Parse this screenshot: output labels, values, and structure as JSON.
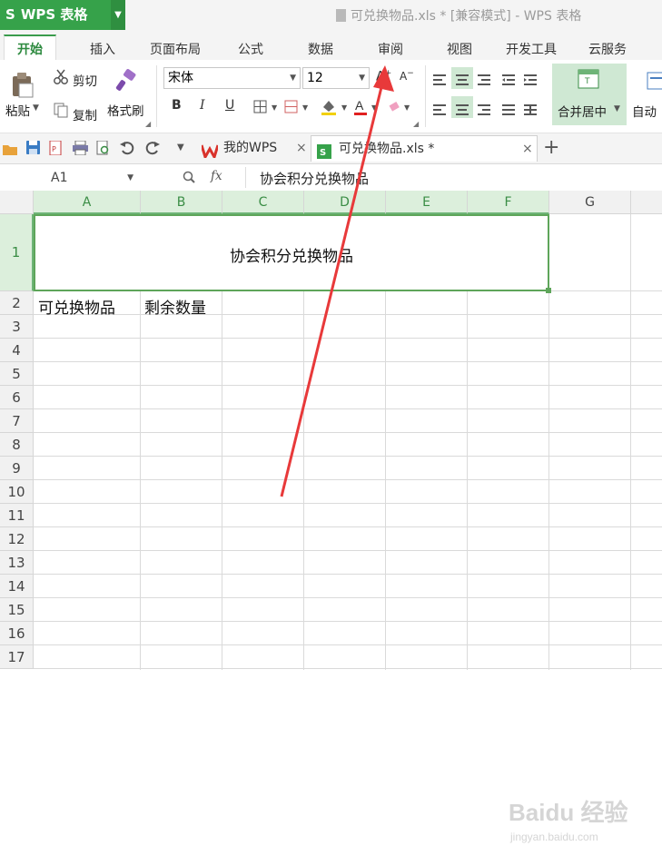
{
  "app": {
    "name": "WPS 表格",
    "logo_glyph": "S"
  },
  "window": {
    "title": "可兑换物品.xls * [兼容模式] - WPS 表格"
  },
  "ribbon_tabs": [
    "开始",
    "插入",
    "页面布局",
    "公式",
    "数据",
    "审阅",
    "视图",
    "开发工具",
    "云服务"
  ],
  "ribbon": {
    "paste": "粘贴",
    "cut": "剪切",
    "copy": "复制",
    "format_painter": "格式刷",
    "font_name": "宋体",
    "font_size": "12",
    "merge_center": "合并居中",
    "auto_wrap": "自动"
  },
  "doc_tabs": [
    {
      "label": "我的WPS"
    },
    {
      "label": "可兑换物品.xls *"
    }
  ],
  "formula_bar": {
    "name_box": "A1",
    "fx": "fx",
    "content": "协会积分兑换物品"
  },
  "columns": [
    "A",
    "B",
    "C",
    "D",
    "E",
    "F",
    "G"
  ],
  "rows": [
    "1",
    "2",
    "3",
    "4",
    "5",
    "6",
    "7",
    "8",
    "9",
    "10",
    "11",
    "12",
    "13",
    "14",
    "15",
    "16",
    "17"
  ],
  "cells": {
    "A1_merged": "协会积分兑换物品",
    "A2": "可兑换物品",
    "B2": "剩余数量"
  },
  "watermark": {
    "brand": "Baidu 经验",
    "url": "jingyan.baidu.com"
  },
  "colors": {
    "accent": "#36a24a",
    "selection": "#5ea55a",
    "arrow": "#e8393a"
  }
}
